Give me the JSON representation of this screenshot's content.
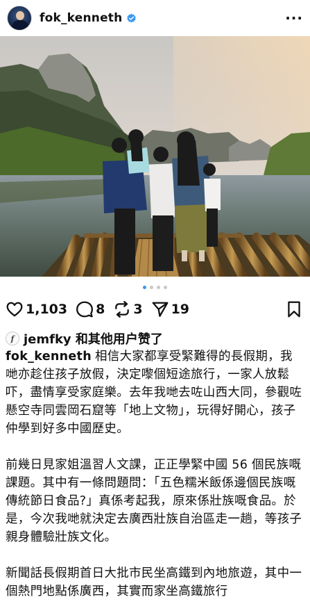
{
  "post": {
    "username": "fok_kenneth",
    "more_icon": "more-horizontal-icon",
    "verified_color": "#3897f0",
    "carousel": {
      "pages": 4,
      "active": 0
    }
  },
  "actions": {
    "likes": "1,103",
    "comments": "8",
    "reposts": "3",
    "shares": "19"
  },
  "liked_by": {
    "avatar_letter": "f",
    "text": "jemfky 和其他用户赞了"
  },
  "caption": {
    "username": "fok_kenneth",
    "p1": "相信大家都享受緊難得的長假期，我哋亦趁住孩子放假，決定嚟個短途旅行，一家人放鬆吓，盡情享受家庭樂。去年我哋去咗山西大同，參觀咗懸空寺同雲岡石窟等「地上文物」，玩得好開心，孩子仲學到好多中國歷史。",
    "p2": "前幾日見家姐溫習人文課，正正學緊中國 56 個民族嘅課題。其中有一條問題問：「五色糯米飯係邊個民族嘅傳統節日食品?」真係考起我，原來係壯族嘅食品。於是，今次我哋就決定去廣西壯族自治區走一趟，等孩子親身體驗壯族文化。",
    "p3": "新聞話長假期首日大批市民坐高鐵到內地旅遊，其中一個熱門地點係廣西，其實而家坐高鐵旅行"
  }
}
